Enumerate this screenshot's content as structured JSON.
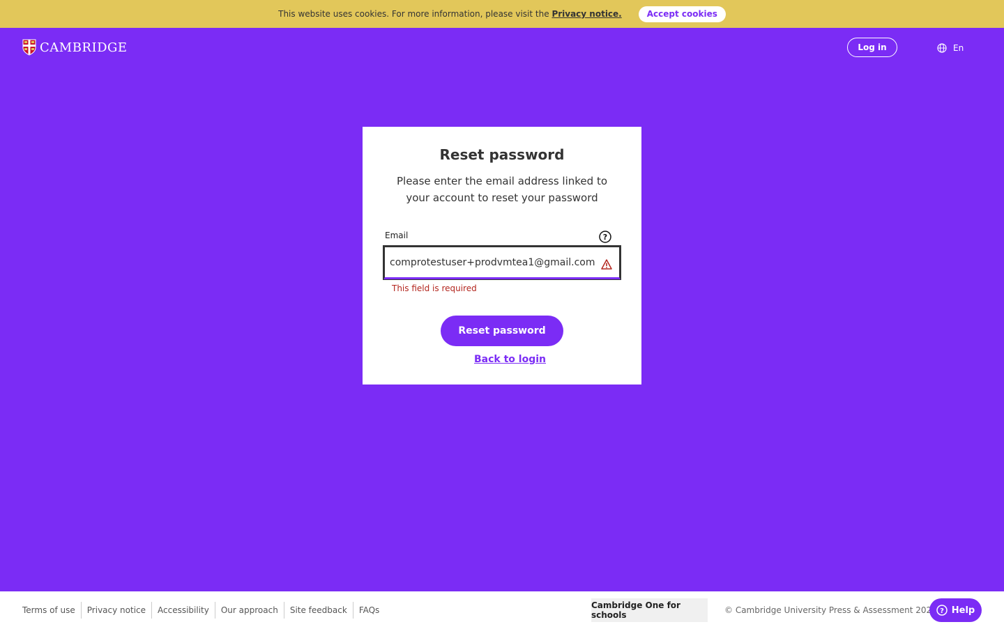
{
  "cookie_banner": {
    "text": "This website uses cookies. For more information, please visit the",
    "link_label": "Privacy notice.",
    "accept_label": "Accept cookies"
  },
  "header": {
    "logo_text": "CAMBRIDGE",
    "login_label": "Log in",
    "language_label": "En"
  },
  "card": {
    "title": "Reset password",
    "description": "Please enter the email address linked to your account to reset your password",
    "email_label": "Email",
    "email_value": "comprotestuser+prodvmtea1@gmail.com",
    "error_message": "This field is required",
    "submit_label": "Reset password",
    "back_link_label": "Back to login"
  },
  "footer": {
    "links": [
      "Terms of use",
      "Privacy notice",
      "Accessibility",
      "Our approach",
      "Site feedback",
      "FAQs"
    ],
    "product_name": "Cambridge One for schools",
    "copyright": "© Cambridge University Press & Assessment 2024",
    "help_label": "Help"
  },
  "colors": {
    "background": "#7b2cf5",
    "cookie_bar": "#e2c75a",
    "error": "#b3261e"
  }
}
